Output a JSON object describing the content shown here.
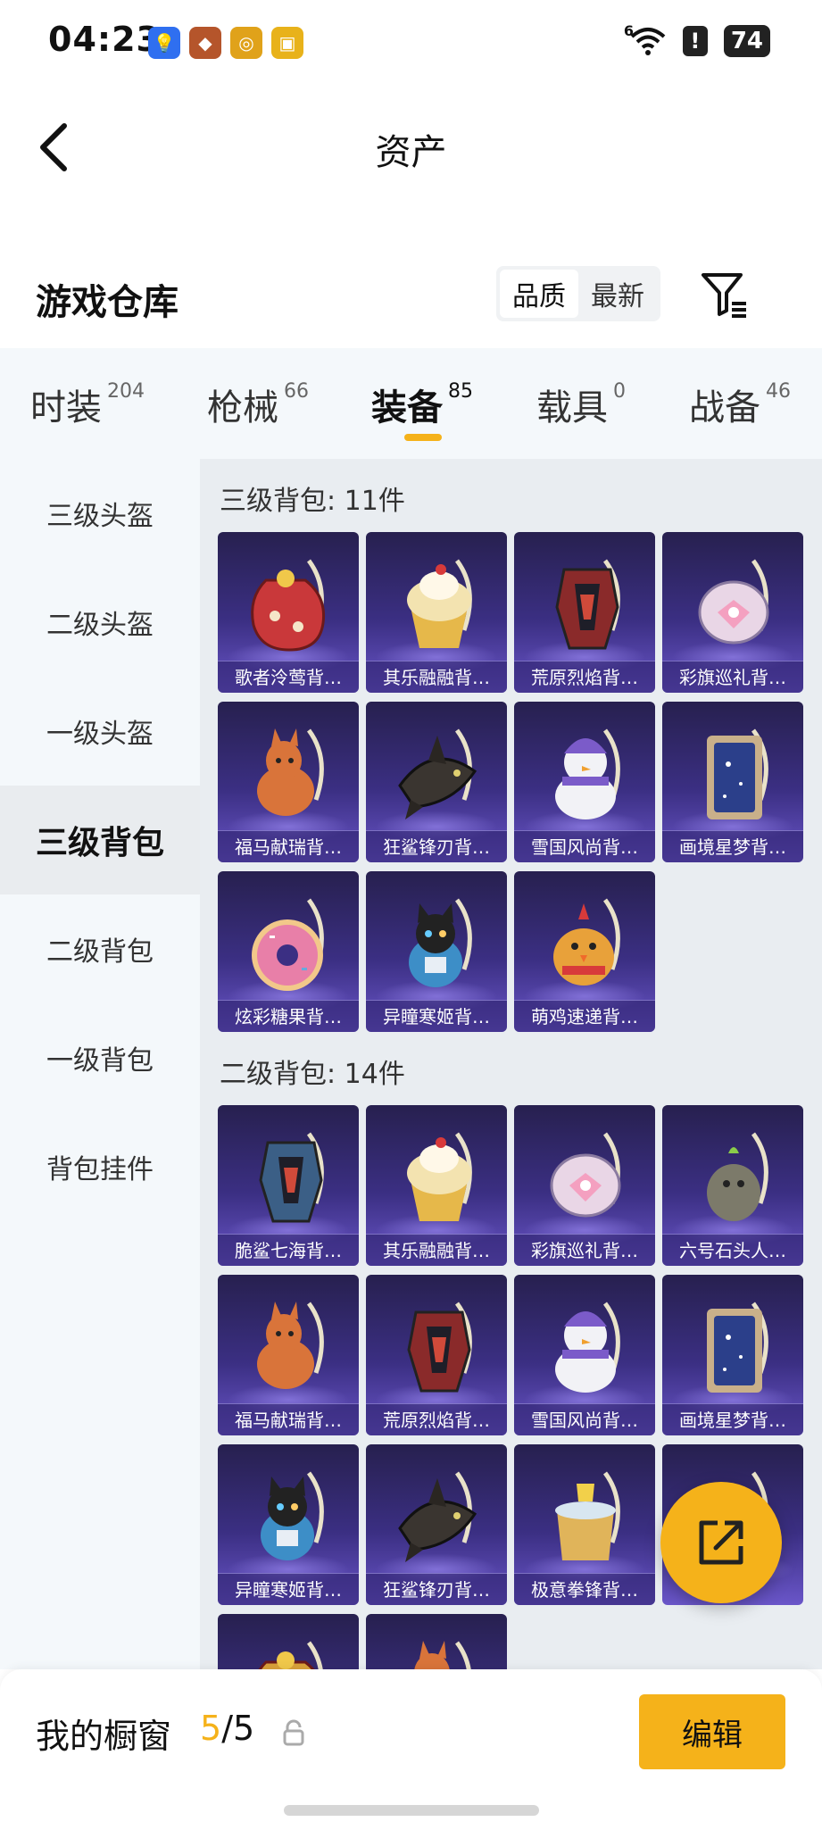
{
  "status_bar": {
    "time": "04:23",
    "network": "6",
    "alert": "!",
    "battery": "74"
  },
  "app_icons": [
    {
      "name": "lightbulb-app-icon",
      "color": "#2f6ff0",
      "glyph": "💡"
    },
    {
      "name": "honor-of-kings-icon",
      "color": "#b5552b",
      "glyph": "◆"
    },
    {
      "name": "target-app-icon",
      "color": "#e0a21a",
      "glyph": "◎"
    },
    {
      "name": "game-peace-elite-icon",
      "color": "#e8b21a",
      "glyph": "▣"
    }
  ],
  "nav": {
    "title": "资产"
  },
  "warehouse": {
    "title": "游戏仓库",
    "sort_options": [
      "品质",
      "最新"
    ],
    "active_sort": "品质"
  },
  "tabs": [
    {
      "label": "时装",
      "count": "204"
    },
    {
      "label": "枪械",
      "count": "66"
    },
    {
      "label": "装备",
      "count": "85"
    },
    {
      "label": "载具",
      "count": "0"
    },
    {
      "label": "战备",
      "count": "46"
    }
  ],
  "active_tab": "装备",
  "sidebar": [
    "三级头盔",
    "二级头盔",
    "一级头盔",
    "三级背包",
    "二级背包",
    "一级背包",
    "背包挂件"
  ],
  "active_sidebar": "三级背包",
  "sections": [
    {
      "title": "三级背包: 11件",
      "items": [
        {
          "label": "歌者泠莺背…",
          "shape": "pouch",
          "color": "#c9383a"
        },
        {
          "label": "其乐融融背…",
          "shape": "cupcake",
          "color": "#f3e3b0"
        },
        {
          "label": "荒原烈焰背…",
          "shape": "armor",
          "color": "#8a2a2a"
        },
        {
          "label": "彩旗巡礼背…",
          "shape": "round",
          "color": "#e9d6e6"
        },
        {
          "label": "福马献瑞背…",
          "shape": "horse",
          "color": "#d9743a"
        },
        {
          "label": "狂鲨锋刃背…",
          "shape": "shark",
          "color": "#3a3530"
        },
        {
          "label": "雪国风尚背…",
          "shape": "snowman",
          "color": "#f2f2f6"
        },
        {
          "label": "画境星梦背…",
          "shape": "frame",
          "color": "#2b3f8a"
        },
        {
          "label": "炫彩糖果背…",
          "shape": "donut",
          "color": "#e87fa8"
        },
        {
          "label": "异瞳寒姬背…",
          "shape": "cat",
          "color": "#3d8ec7"
        },
        {
          "label": "萌鸡速递背…",
          "shape": "chick",
          "color": "#e8a13a"
        }
      ]
    },
    {
      "title": "二级背包: 14件",
      "items": [
        {
          "label": "脆鲨七海背…",
          "shape": "armor",
          "color": "#3b5f86"
        },
        {
          "label": "其乐融融背…",
          "shape": "cupcake",
          "color": "#f3e3b0"
        },
        {
          "label": "彩旗巡礼背…",
          "shape": "round",
          "color": "#e9d6e6"
        },
        {
          "label": "六号石头人…",
          "shape": "rock",
          "color": "#7c7a6a"
        },
        {
          "label": "福马献瑞背…",
          "shape": "horse",
          "color": "#d9743a"
        },
        {
          "label": "荒原烈焰背…",
          "shape": "armor",
          "color": "#8a2a2a"
        },
        {
          "label": "雪国风尚背…",
          "shape": "snowman",
          "color": "#f2f2f6"
        },
        {
          "label": "画境星梦背…",
          "shape": "frame",
          "color": "#2b3f8a"
        },
        {
          "label": "异瞳寒姬背…",
          "shape": "cat",
          "color": "#3d8ec7"
        },
        {
          "label": "狂鲨锋刃背…",
          "shape": "shark",
          "color": "#3a3530"
        },
        {
          "label": "极意拳锋背…",
          "shape": "box",
          "color": "#e0b45a"
        },
        {
          "label": "",
          "shape": "round",
          "color": "#e9a0b0"
        },
        {
          "label": "",
          "shape": "pouch",
          "color": "#d9a13a"
        },
        {
          "label": "",
          "shape": "horse",
          "color": "#d9743a"
        }
      ]
    }
  ],
  "bottom_bar": {
    "label": "我的橱窗",
    "current": "5",
    "total": "/5",
    "edit": "编辑"
  },
  "colors": {
    "accent": "#f5b21a",
    "card_top": "#27204f",
    "card_bottom": "#6a56c9"
  }
}
